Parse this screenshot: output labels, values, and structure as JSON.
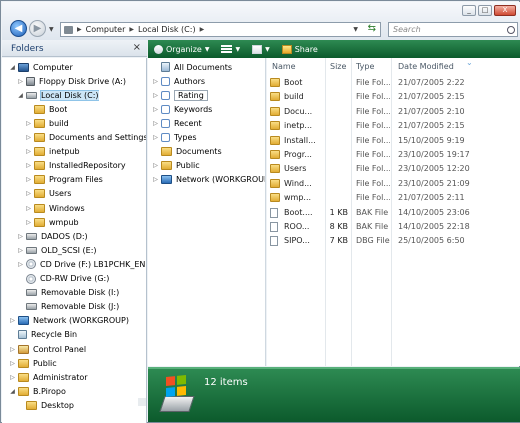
{
  "window": {
    "buttons": {
      "minimize": "_",
      "maximize": "□",
      "close": "X"
    }
  },
  "address": {
    "crumbs": [
      "Computer",
      "Local Disk (C:)"
    ]
  },
  "search": {
    "placeholder": "Search"
  },
  "folders_pane": {
    "header": "Folders",
    "close": "×",
    "tree": [
      {
        "label": "Computer",
        "icon": "computer-icon",
        "indent": 0,
        "expander": "◢"
      },
      {
        "label": "Floppy Disk Drive (A:)",
        "icon": "floppy-icon",
        "indent": 1,
        "expander": "▷"
      },
      {
        "label": "Local Disk (C:)",
        "icon": "drive-icon",
        "indent": 1,
        "expander": "◢",
        "selected": true
      },
      {
        "label": "Boot",
        "icon": "folder-icon",
        "indent": 2,
        "expander": ""
      },
      {
        "label": "build",
        "icon": "folder-icon",
        "indent": 2,
        "expander": "▷"
      },
      {
        "label": "Documents and Settings",
        "icon": "folder-icon",
        "indent": 2,
        "expander": "▷"
      },
      {
        "label": "inetpub",
        "icon": "folder-icon",
        "indent": 2,
        "expander": "▷"
      },
      {
        "label": "InstalledRepository",
        "icon": "folder-icon",
        "indent": 2,
        "expander": "▷"
      },
      {
        "label": "Program Files",
        "icon": "folder-icon",
        "indent": 2,
        "expander": "▷"
      },
      {
        "label": "Users",
        "icon": "folder-icon",
        "indent": 2,
        "expander": "▷"
      },
      {
        "label": "Windows",
        "icon": "folder-icon",
        "indent": 2,
        "expander": "▷"
      },
      {
        "label": "wmpub",
        "icon": "folder-icon",
        "indent": 2,
        "expander": "▷"
      },
      {
        "label": "DADOS (D:)",
        "icon": "drive-icon",
        "indent": 1,
        "expander": "▷"
      },
      {
        "label": "OLD_SCSI (E:)",
        "icon": "drive-icon",
        "indent": 1,
        "expander": "▷"
      },
      {
        "label": "CD Drive (F:) LB1PCHK_EN",
        "icon": "cd-icon",
        "indent": 1,
        "expander": "▷"
      },
      {
        "label": "CD-RW Drive (G:)",
        "icon": "cd-icon",
        "indent": 1,
        "expander": ""
      },
      {
        "label": "Removable Disk (I:)",
        "icon": "drive-icon",
        "indent": 1,
        "expander": ""
      },
      {
        "label": "Removable Disk (J:)",
        "icon": "drive-icon",
        "indent": 1,
        "expander": ""
      },
      {
        "label": "Network (WORKGROUP)",
        "icon": "network-icon",
        "indent": 0,
        "expander": "▷"
      },
      {
        "label": "Recycle Bin",
        "icon": "recycle-bin-icon",
        "indent": 0,
        "expander": ""
      },
      {
        "label": "Control Panel",
        "icon": "control-panel-icon",
        "indent": 0,
        "expander": "▷"
      },
      {
        "label": "Public",
        "icon": "folder-icon",
        "indent": 0,
        "expander": "▷"
      },
      {
        "label": "Administrator",
        "icon": "user-folder-icon",
        "indent": 0,
        "expander": "▷"
      },
      {
        "label": "B.Piropo",
        "icon": "user-folder-icon",
        "indent": 0,
        "expander": "◢"
      },
      {
        "label": "Desktop",
        "icon": "folder-icon",
        "indent": 1,
        "expander": ""
      }
    ]
  },
  "toolbar": {
    "organize": "Organize",
    "views": "",
    "layout": "",
    "share": "Share"
  },
  "nav_pane": {
    "items": [
      {
        "label": "All Documents",
        "icon": "all-documents-icon"
      },
      {
        "label": "Authors",
        "icon": "authors-icon"
      },
      {
        "label": "Rating",
        "icon": "rating-icon"
      },
      {
        "label": "Keywords",
        "icon": "keywords-icon"
      },
      {
        "label": "Recent",
        "icon": "recent-icon"
      },
      {
        "label": "Types",
        "icon": "types-icon"
      },
      {
        "label": "Documents",
        "icon": "folder-icon"
      },
      {
        "label": "Public",
        "icon": "folder-icon"
      },
      {
        "label": "Network (WORKGROUP)",
        "icon": "network-icon"
      }
    ]
  },
  "file_list": {
    "columns": {
      "name": "Name",
      "size": "Size",
      "type": "Type",
      "date": "Date Modified"
    },
    "rows": [
      {
        "name": "Boot",
        "size": "",
        "type": "File Fol...",
        "date": "21/07/2005 2:22",
        "kind": "folder"
      },
      {
        "name": "build",
        "size": "",
        "type": "File Fol...",
        "date": "21/07/2005 2:15",
        "kind": "folder"
      },
      {
        "name": "Docu...",
        "size": "",
        "type": "File Fol...",
        "date": "21/07/2005 2:10",
        "kind": "folder"
      },
      {
        "name": "inetp...",
        "size": "",
        "type": "File Fol...",
        "date": "21/07/2005 2:15",
        "kind": "folder"
      },
      {
        "name": "Install...",
        "size": "",
        "type": "File Fol...",
        "date": "15/10/2005 9:19",
        "kind": "folder"
      },
      {
        "name": "Progr...",
        "size": "",
        "type": "File Fol...",
        "date": "23/10/2005 19:17",
        "kind": "folder"
      },
      {
        "name": "Users",
        "size": "",
        "type": "File Fol...",
        "date": "23/10/2005 12:20",
        "kind": "folder"
      },
      {
        "name": "Wind...",
        "size": "",
        "type": "File Fol...",
        "date": "23/10/2005 21:09",
        "kind": "folder"
      },
      {
        "name": "wmp...",
        "size": "",
        "type": "File Fol...",
        "date": "21/07/2005 2:11",
        "kind": "folder"
      },
      {
        "name": "Boot....",
        "size": "1 KB",
        "type": "BAK File",
        "date": "14/10/2005 23:06",
        "kind": "doc"
      },
      {
        "name": "ROO...",
        "size": "8 KB",
        "type": "BAK File",
        "date": "14/10/2005 22:18",
        "kind": "doc"
      },
      {
        "name": "SIPO...",
        "size": "7 KB",
        "type": "DBG File",
        "date": "25/10/2005 6:50",
        "kind": "doc"
      }
    ]
  },
  "details_pane": {
    "count": "12 items"
  },
  "colors": {
    "accent": "#0b5a2c",
    "selection": "#cde6f7"
  }
}
